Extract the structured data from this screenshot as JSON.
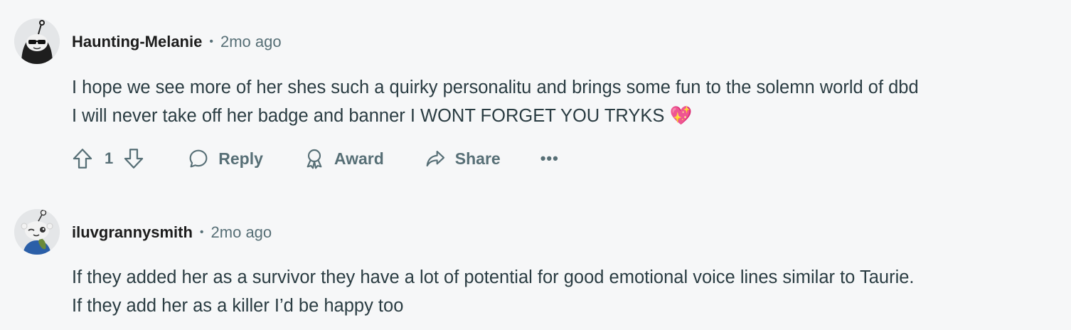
{
  "comments": [
    {
      "username": "Haunting-Melanie",
      "separator": "•",
      "time": "2mo ago",
      "lines": [
        "I hope we see more of her shes such a quirky personalitu and brings some fun to the solemn world of dbd",
        "I will never take off her badge and banner I WONT FORGET YOU TRYKS 💖"
      ],
      "votes": "1",
      "actions": {
        "reply": "Reply",
        "award": "Award",
        "share": "Share",
        "more": "•••"
      }
    },
    {
      "username": "iluvgrannysmith",
      "separator": "•",
      "time": "2mo ago",
      "lines": [
        "If they added her as a survivor they have a lot of potential for good emotional voice lines similar to Taurie.",
        "If they add her as a killer I’d be happy too"
      ]
    }
  ],
  "icons": {
    "upvote": "upvote-arrow-icon",
    "downvote": "downvote-arrow-icon",
    "reply": "speech-bubble-icon",
    "award": "award-ribbon-icon",
    "share": "share-arrow-icon",
    "more": "more-horizontal-icon"
  },
  "colors": {
    "background": "#f6f7f8",
    "username": "#1c1c1c",
    "meta": "#576f76",
    "body": "#2a3c42"
  }
}
